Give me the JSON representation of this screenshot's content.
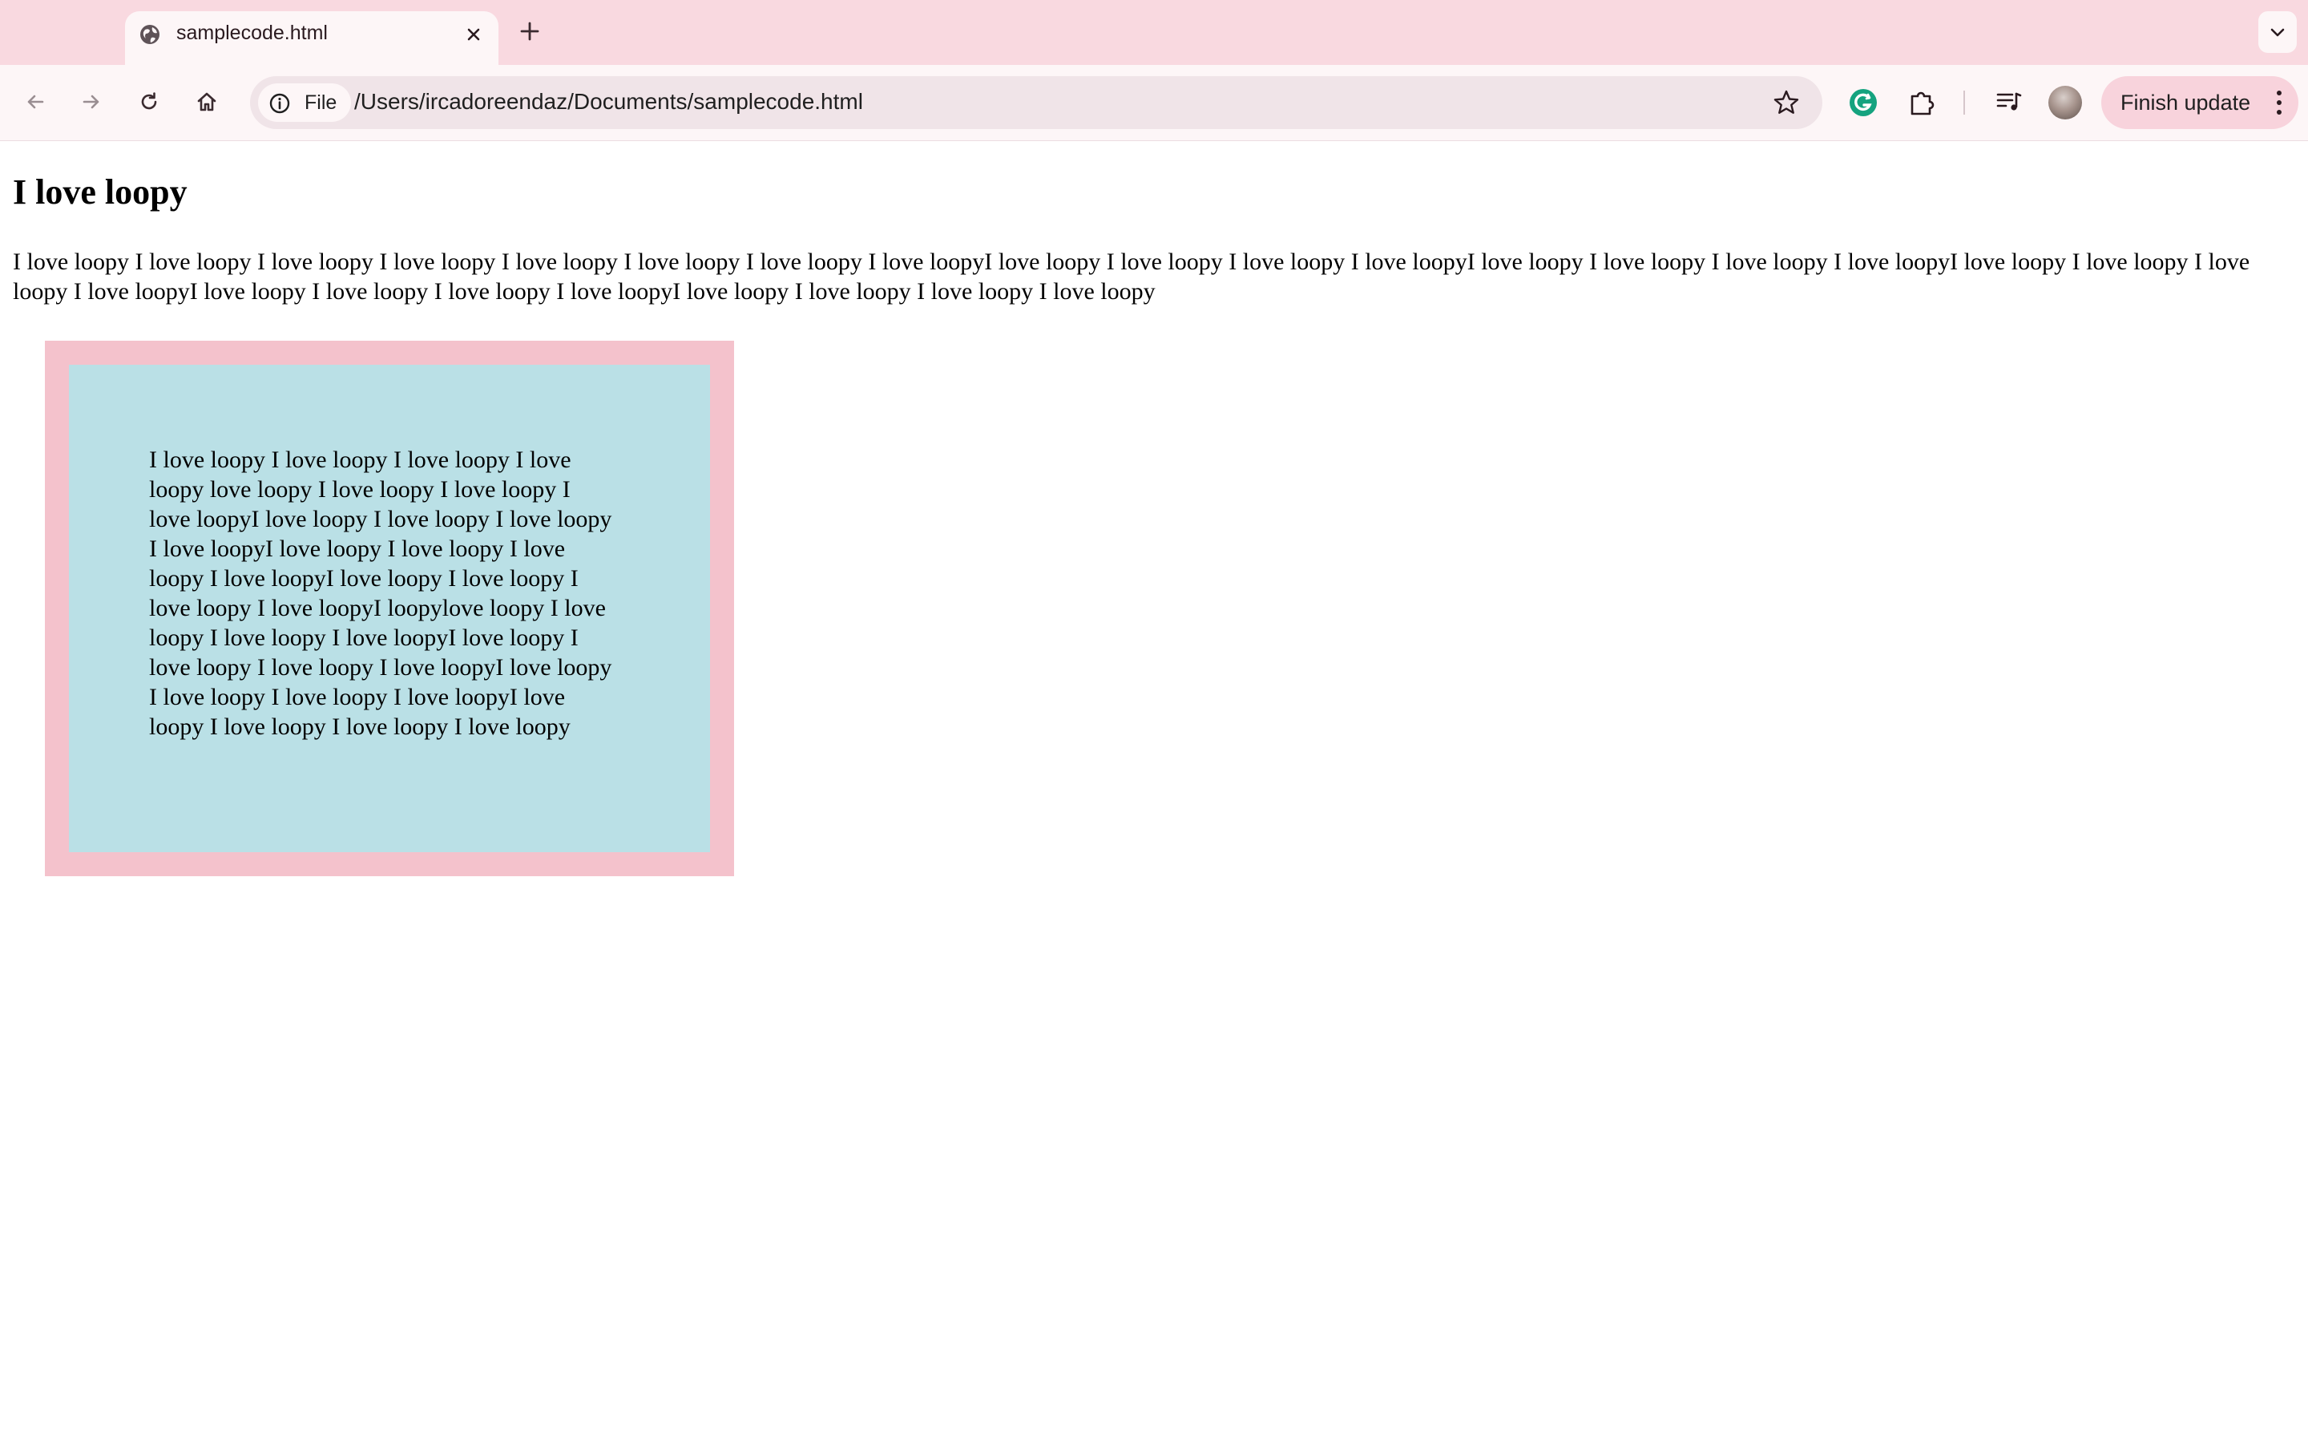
{
  "tab": {
    "title": "samplecode.html",
    "favicon": "globe-icon"
  },
  "toolbar": {
    "site_chip_label": "File",
    "url": "/Users/ircadoreendaz/Documents/samplecode.html",
    "finish_update_label": "Finish update"
  },
  "page": {
    "heading": "I love loopy",
    "paragraph": "I love loopy I love loopy I love loopy I love loopy I love loopy I love loopy I love loopy I love loopyI love loopy I love loopy I love loopy I love loopyI love loopy I love loopy I love loopy I love loopyI love loopy I love loopy I love loopy I love loopyI love loopy I love loopy I love loopy I love loopyI love loopy I love loopy I love loopy I love loopy",
    "box_text": "I love loopy I love loopy I love loopy I love loopy love loopy I love loopy I love loopy I love loopyI love loopy I love loopy I love loopy I love loopyI love loopy I love loopy I love loopy I love loopyI love loopy I love loopy I love loopy I love loopyI loopylove loopy I love loopy I love loopy I love loopyI love loopy I love loopy I love loopy I love loopyI love loopy I love loopy I love loopy I love loopyI love loopy I love loopy I love loopy I love loopy"
  },
  "colors": {
    "tabstrip": "#f9d9e0",
    "toolbar": "#fdf6f7",
    "omnibox": "#f0e4e8",
    "finish_update": "#f8d3dc",
    "pink_box": "#f4c2cc",
    "blue_box": "#bae0e6",
    "grammarly": "#15a37f"
  }
}
